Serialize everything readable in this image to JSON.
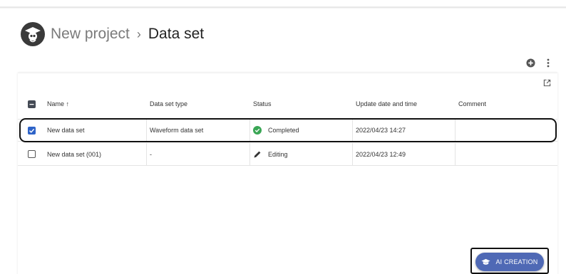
{
  "breadcrumb": {
    "project": "New project",
    "separator": "›",
    "current": "Data set"
  },
  "toolbar": {
    "add_icon": "add-circle-icon",
    "more_icon": "more-vertical-icon",
    "open_external_icon": "open-in-new-icon"
  },
  "table": {
    "columns": [
      "Name ↑",
      "Data set type",
      "Status",
      "Update date and time",
      "Comment"
    ],
    "rows": [
      {
        "selected": true,
        "name": "New data set",
        "type": "Waveform data set",
        "status": "Completed",
        "status_icon": "check-circle-icon",
        "updated": "2022/04/23 14:27",
        "comment": ""
      },
      {
        "selected": false,
        "name": "New data set (001)",
        "type": "-",
        "status": "Editing",
        "status_icon": "pencil-icon",
        "updated": "2022/04/23 12:49",
        "comment": ""
      }
    ]
  },
  "fab": {
    "label": "AI CREATION",
    "icon": "graduation-cap-icon"
  },
  "colors": {
    "accent": "#2e63c8",
    "fab": "#4f69b5",
    "success": "#3aa655"
  }
}
